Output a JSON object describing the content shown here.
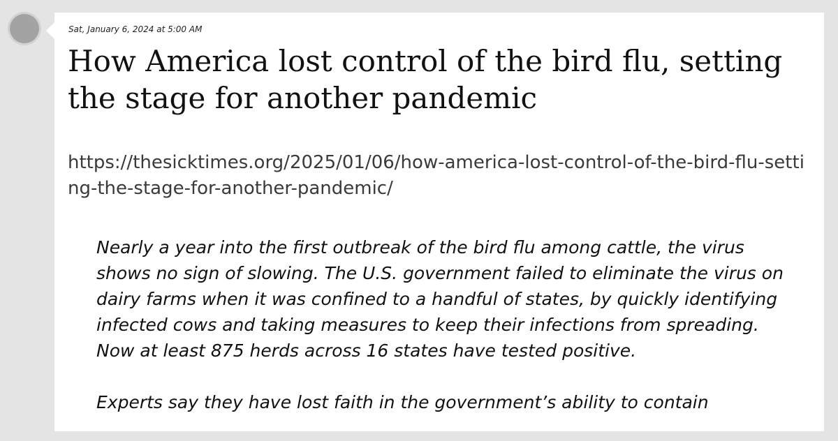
{
  "post": {
    "timestamp": "Sat, January 6, 2024 at 5:00 AM",
    "title": "How America lost control of the bird flu, setting the stage for another pandemic",
    "url": "https://thesicktimes.org/2025/01/06/how-america-lost-control-of-the-bird-flu-setting-the-stage-for-another-pandemic/",
    "quote_paragraphs": [
      "Nearly a year into the first outbreak of the bird flu among cattle, the virus shows no sign of slowing. The U.S. government failed to eliminate the virus on dairy farms when it was confined to a handful of states, by quickly identifying infected cows and taking measures to keep their infections from spreading. Now at least 875 herds across 16 states have tested positive.",
      "Experts say they have lost faith in the government’s ability to contain"
    ]
  },
  "colors": {
    "page_background": "#e4e4e4",
    "card_background": "#ffffff",
    "avatar": "#a3a3a3"
  }
}
